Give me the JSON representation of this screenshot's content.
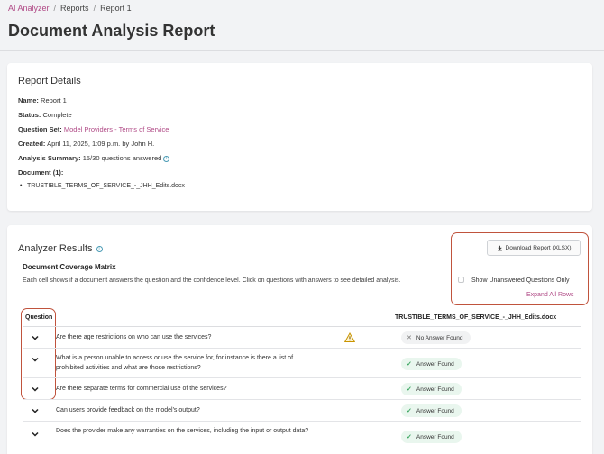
{
  "breadcrumb": {
    "root": "AI Analyzer",
    "section": "Reports",
    "current": "Report 1",
    "separator": "/"
  },
  "page_title": "Document Analysis Report",
  "details": {
    "title": "Report Details",
    "name_label": "Name:",
    "name_value": "Report 1",
    "status_label": "Status:",
    "status_value": "Complete",
    "question_set_label": "Question Set:",
    "question_set_value": "Model Providers - Terms of Service",
    "created_label": "Created:",
    "created_value": "April 11, 2025, 1:09 p.m. by John H.",
    "summary_label": "Analysis Summary:",
    "summary_value": "15/30 questions answered",
    "document_label": "Document (1):",
    "documents": [
      "TRUSTIBLE_TERMS_OF_SERVICE_-_JHH_Edits.docx"
    ]
  },
  "results": {
    "title": "Analyzer Results",
    "coverage_title": "Document Coverage Matrix",
    "coverage_desc": "Each cell shows if a document answers the question and the confidence level. Click on questions with answers to see detailed analysis.",
    "download_label": "Download Report (XLSX)",
    "checkbox_label": "Show Unanswered Questions Only",
    "checkbox_checked": false,
    "expand_label": "Expand All Rows",
    "col_question": "Question",
    "col_document": "TRUSTIBLE_TERMS_OF_SERVICE_-_JHH_Edits.docx",
    "rows": [
      {
        "question": "Are there age restrictions on who can use the services?",
        "status": "No Answer Found",
        "warning": true
      },
      {
        "question": "What is a person unable to access or use the service for, for instance is there a list of prohibited activities and what are those restrictions?",
        "status": "Answer Found",
        "warning": false
      },
      {
        "question": "Are there separate terms for commercial use of the services?",
        "status": "Answer Found",
        "warning": false
      },
      {
        "question": "Can users provide feedback on the model's output?",
        "status": "Answer Found",
        "warning": false
      },
      {
        "question": "Does the provider make any warranties on the services, including the input or output data?",
        "status": "Answer Found",
        "warning": false
      }
    ]
  },
  "colors": {
    "accent": "#b04a86",
    "annotation": "#c0533d",
    "found": "#3aa55e",
    "warning": "#e0a800"
  },
  "icons": {
    "info": "info-icon",
    "download": "download-icon",
    "chevron": "chevron-down-icon",
    "warning": "warning-icon",
    "check": "check-icon",
    "cross": "x-icon"
  }
}
